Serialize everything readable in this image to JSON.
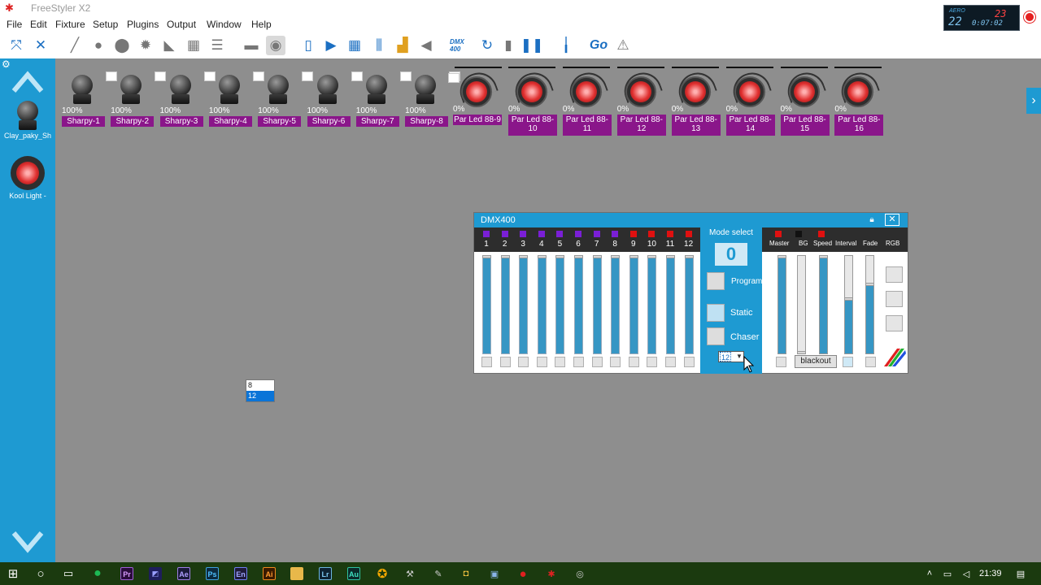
{
  "window": {
    "title": "FreeStyler X2"
  },
  "clock": {
    "label": "AERO",
    "value_a": "22",
    "value_b": "23",
    "value_c": "0:07:02"
  },
  "menu": [
    "File",
    "Edit",
    "Fixture",
    "Setup",
    "Plugins",
    "Output",
    "Window",
    "Help"
  ],
  "toolbar": {
    "dmx_label": "DMX\n400",
    "go_label": "Go"
  },
  "sidebar": {
    "fixtures": [
      {
        "label": "Clay_paky_Sh",
        "icon": "moving-head-icon"
      },
      {
        "label": "Kool Light -",
        "icon": "par-led-icon"
      }
    ]
  },
  "fixtures": [
    {
      "label": "Sharpy-1",
      "pct": "100%"
    },
    {
      "label": "Sharpy-2",
      "pct": "100%"
    },
    {
      "label": "Sharpy-3",
      "pct": "100%"
    },
    {
      "label": "Sharpy-4",
      "pct": "100%"
    },
    {
      "label": "Sharpy-5",
      "pct": "100%"
    },
    {
      "label": "Sharpy-6",
      "pct": "100%"
    },
    {
      "label": "Sharpy-7",
      "pct": "100%"
    },
    {
      "label": "Sharpy-8",
      "pct": "100%"
    },
    {
      "label": "Par Led 88-9",
      "pct": "0%"
    },
    {
      "label": "Par Led 88-\n10",
      "pct": "0%"
    },
    {
      "label": "Par Led 88-\n11",
      "pct": "0%"
    },
    {
      "label": "Par Led 88-\n12",
      "pct": "0%"
    },
    {
      "label": "Par Led 88-\n13",
      "pct": "0%"
    },
    {
      "label": "Par Led 88-\n14",
      "pct": "0%"
    },
    {
      "label": "Par Led 88-\n15",
      "pct": "0%"
    },
    {
      "label": "Par Led 88-\n16",
      "pct": "0%"
    }
  ],
  "dmx": {
    "title": "DMX400",
    "channels": [
      {
        "num": "1",
        "color": "#7a1fd6"
      },
      {
        "num": "2",
        "color": "#7a1fd6"
      },
      {
        "num": "3",
        "color": "#7a1fd6"
      },
      {
        "num": "4",
        "color": "#7a1fd6"
      },
      {
        "num": "5",
        "color": "#7a1fd6"
      },
      {
        "num": "6",
        "color": "#7a1fd6"
      },
      {
        "num": "7",
        "color": "#7a1fd6"
      },
      {
        "num": "8",
        "color": "#7a1fd6"
      },
      {
        "num": "9",
        "color": "#e01010"
      },
      {
        "num": "10",
        "color": "#e01010"
      },
      {
        "num": "11",
        "color": "#e01010"
      },
      {
        "num": "12",
        "color": "#e01010"
      }
    ],
    "mode": {
      "title": "Mode select",
      "number": "0",
      "program_label": "Program",
      "static_label": "Static",
      "chaser_label": "Chaser",
      "selected": "12",
      "options": [
        "8",
        "12"
      ]
    },
    "master": {
      "labels": [
        "Master",
        "BG",
        "Speed",
        "Interval",
        "Fade",
        "RGB"
      ],
      "dot_colors": [
        "#e01010",
        "#111111",
        "#e01010"
      ],
      "levels": [
        1.0,
        0.0,
        1.0,
        0.55,
        0.7
      ],
      "blackout_label": "blackout"
    }
  },
  "taskbar": {
    "time": "21:39"
  }
}
